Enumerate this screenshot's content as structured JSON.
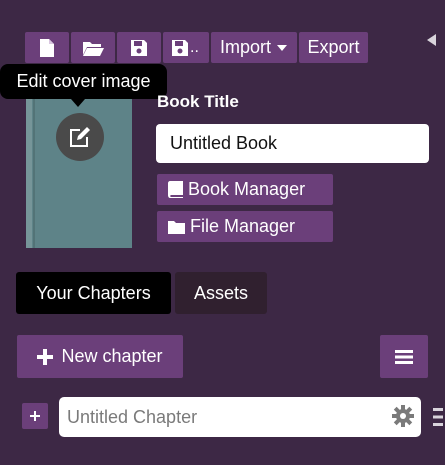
{
  "toolbar": {
    "import_label": "Import",
    "export_label": "Export",
    "icons": [
      "new-file-icon",
      "open-folder-icon",
      "save-icon",
      "save-as-icon"
    ],
    "save_as_suffix": ".."
  },
  "tooltip": {
    "text": "Edit cover image"
  },
  "book": {
    "title_label": "Book Title",
    "title_value": "Untitled Book",
    "cover_color": "#5e8388"
  },
  "managers": {
    "book_manager": "Book Manager",
    "file_manager": "File Manager"
  },
  "tabs": [
    {
      "label": "Your Chapters",
      "active": true
    },
    {
      "label": "Assets",
      "active": false
    }
  ],
  "actions": {
    "new_chapter": "New chapter"
  },
  "chapters": [
    {
      "placeholder": "Untitled Chapter",
      "value": ""
    }
  ],
  "colors": {
    "background": "#3d2845",
    "button": "#6b3f7a",
    "active_tab": "#000000",
    "inactive_tab": "#30202f"
  }
}
